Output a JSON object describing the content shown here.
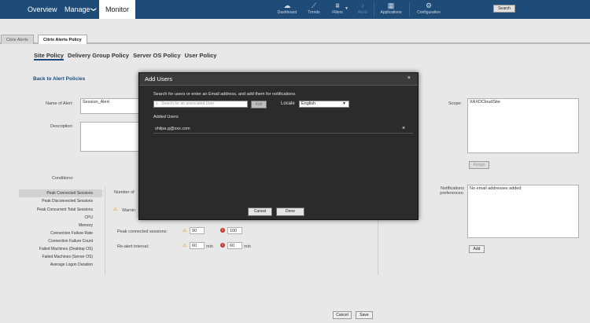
{
  "nav": {
    "overview": "Overview",
    "manage": "Manage",
    "chev": "❯",
    "monitor": "Monitor"
  },
  "toolbar": {
    "dashboard": "Dashboard",
    "trends": "Trends",
    "filters": "Filters",
    "alerts": "Alerts",
    "applications": "Applications",
    "configuration": "Configuration",
    "search": "Search"
  },
  "tabs": {
    "citrix_alerts": "Citrix Alerts",
    "citrix_alerts_policy": "Citrix Alerts Policy"
  },
  "policy_tabs": [
    "Site Policy",
    "Delivery Group Policy",
    "Server OS Policy",
    "User Policy"
  ],
  "form": {
    "back": "Back to Alert Policies",
    "name_label": "Name of Alert:",
    "name_value": "Session_Alert",
    "description_label": "Description:",
    "conditions_label": "Conditions:",
    "number_of": "Number of",
    "warning": "Warnin",
    "peak_label": "Peak connected sessions:",
    "peak_warn": "90",
    "peak_crit": "100",
    "realert_label": "Re-alert interval:",
    "realert_warn": "60",
    "realert_crit": "60",
    "min": "min",
    "scope_label": "Scope:",
    "scope_value": "XAXDCloudSite",
    "assign": "Assign",
    "notif_label": "Notifications preferences:",
    "notif_value": "No email addresses added",
    "add": "Add",
    "cancel": "Cancel",
    "save": "Save"
  },
  "conditions": [
    "Peak Connected Sessions",
    "Peak Disconnected Sessions",
    "Peak Concurrent Total Sessions",
    "CPU",
    "Memory",
    "Connection Failure Rate",
    "Connection Failure Count",
    "Failed Machines (Desktop OS)",
    "Failed Machines (Server OS)",
    "Average Logon Duration"
  ],
  "modal": {
    "title": "Add Users",
    "close": "×",
    "instructions": "Search for users or enter an Email address, and add them for notifications.",
    "search_placeholder": "Search for an associated User",
    "add": "Add",
    "locale_label": "Locale",
    "locale_value": "English",
    "added_users_label": "Added Users",
    "users": [
      "shilpa.g@xxx.com"
    ],
    "remove": "×",
    "cancel": "Cancel",
    "done": "Done"
  }
}
